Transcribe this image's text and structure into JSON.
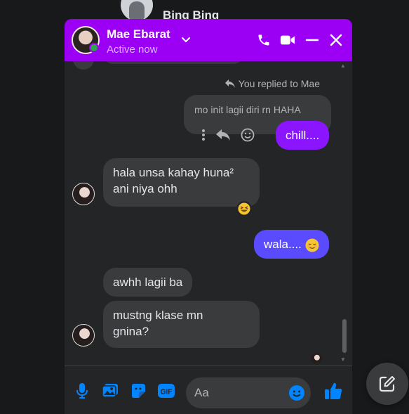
{
  "background_contact": {
    "name": "Bing Bing"
  },
  "header": {
    "name": "Mae Ebarat",
    "status": "Active now",
    "color": "#9b00f5"
  },
  "messages": {
    "reply_note": "You replied to Mae",
    "quoted_text": "mo init lagii diri rn HAHA",
    "m1": "chill....",
    "m2_line1": "hala unsa kahay huna²",
    "m2_line2": "ani niya ohh",
    "m3": "wala....",
    "m4": "awhh lagii ba",
    "m5_line1": "mustng klase mn",
    "m5_line2": "gnina?"
  },
  "composer": {
    "placeholder": "Aa",
    "accent": "#0084ff"
  },
  "icons": [
    "phone-icon",
    "video-icon",
    "minimize-icon",
    "close-icon",
    "mic-icon",
    "image-icon",
    "sticker-icon",
    "gif-icon",
    "emoji-icon",
    "like-icon",
    "new-message-icon"
  ]
}
